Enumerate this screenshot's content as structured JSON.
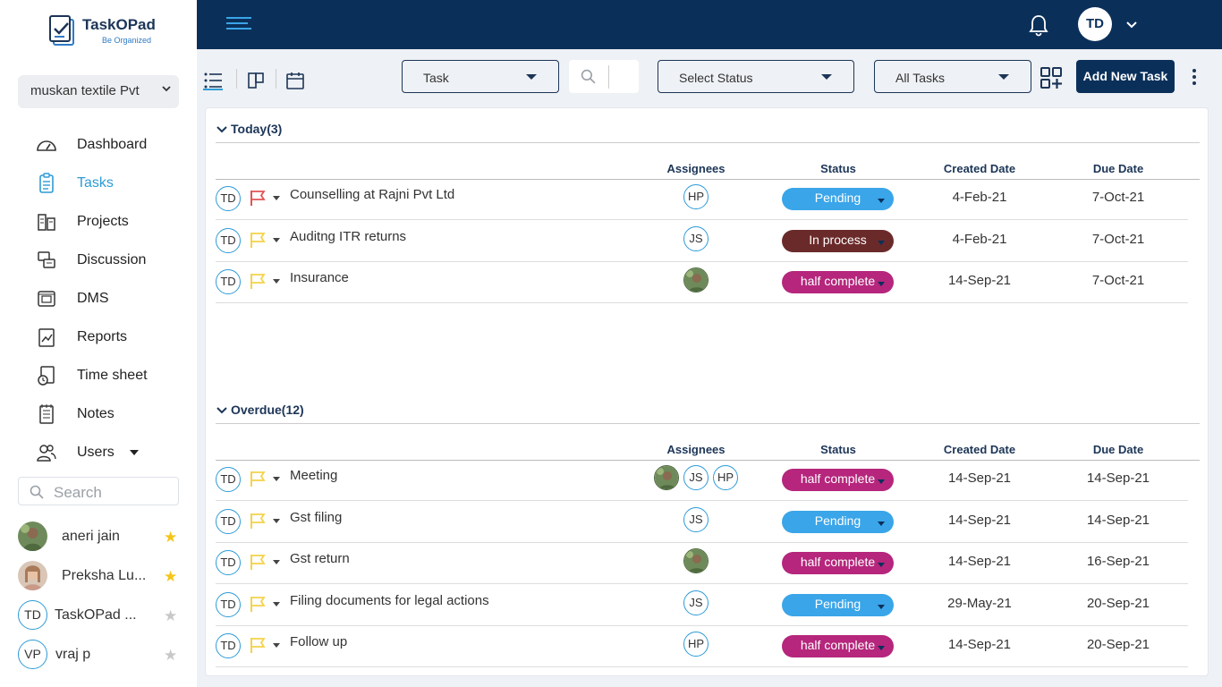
{
  "app": {
    "logo_title": "TaskOPad",
    "logo_tagline": "Be Organized",
    "company": "muskan textile Pvt",
    "colors": {
      "navy": "#0a305a",
      "accent": "#2e9bd6",
      "pending": "#3aa5e8",
      "in_process": "#6b2a2a",
      "half_complete": "#b5267c",
      "flag_red": "#e05555",
      "flag_yellow": "#f4d34a",
      "star_gold": "#f5c518",
      "star_gray": "#c8c8c8"
    }
  },
  "nav": [
    {
      "label": "Dashboard",
      "icon": "speedometer-icon"
    },
    {
      "label": "Tasks",
      "icon": "clipboard-icon",
      "active": true
    },
    {
      "label": "Projects",
      "icon": "projects-icon"
    },
    {
      "label": "Discussion",
      "icon": "discussion-icon"
    },
    {
      "label": "DMS",
      "icon": "dms-icon"
    },
    {
      "label": "Reports",
      "icon": "reports-icon"
    },
    {
      "label": "Time sheet",
      "icon": "clock-icon"
    },
    {
      "label": "Notes",
      "icon": "notes-icon"
    },
    {
      "label": "Users",
      "icon": "users-icon"
    }
  ],
  "sidebar_search": {
    "placeholder": "Search"
  },
  "contacts": [
    {
      "name": "aneri jain",
      "avatar": "photo",
      "starred": true
    },
    {
      "name": "Preksha Lu...",
      "avatar": "photo",
      "starred": true
    },
    {
      "name": "TaskOPad ...",
      "initials": "TD",
      "starred": false
    },
    {
      "name": "vraj p",
      "initials": "VP",
      "starred": false
    }
  ],
  "topbar": {
    "user_initials": "TD"
  },
  "toolbar": {
    "type_select": "Task",
    "status_select": "Select Status",
    "filter_select": "All Tasks",
    "add_button": "Add New Task"
  },
  "columns": {
    "assignees": "Assignees",
    "status": "Status",
    "created": "Created Date",
    "due": "Due Date"
  },
  "sections": [
    {
      "title": "Today(3)",
      "rows": [
        {
          "owner": "TD",
          "flag": "red",
          "name": "Counselling at Rajni Pvt Ltd",
          "assignees": [
            "HP"
          ],
          "status": "Pending",
          "status_type": "pending",
          "created": "4-Feb-21",
          "due": "7-Oct-21"
        },
        {
          "owner": "TD",
          "flag": "yellow",
          "name": "Auditng ITR returns",
          "assignees": [
            "JS"
          ],
          "status": "In process",
          "status_type": "in_process",
          "created": "4-Feb-21",
          "due": "7-Oct-21"
        },
        {
          "owner": "TD",
          "flag": "yellow",
          "name": "Insurance",
          "assignees": [
            "photo"
          ],
          "status": "half complete",
          "status_type": "half_complete",
          "created": "14-Sep-21",
          "due": "7-Oct-21"
        }
      ]
    },
    {
      "title": "Overdue(12)",
      "rows": [
        {
          "owner": "TD",
          "flag": "yellow",
          "name": "Meeting",
          "assignees": [
            "photo",
            "JS",
            "HP"
          ],
          "status": "half complete",
          "status_type": "half_complete",
          "created": "14-Sep-21",
          "due": "14-Sep-21"
        },
        {
          "owner": "TD",
          "flag": "yellow",
          "name": "Gst filing",
          "assignees": [
            "JS"
          ],
          "status": "Pending",
          "status_type": "pending",
          "created": "14-Sep-21",
          "due": "14-Sep-21"
        },
        {
          "owner": "TD",
          "flag": "yellow",
          "name": "Gst return",
          "assignees": [
            "photo"
          ],
          "status": "half complete",
          "status_type": "half_complete",
          "created": "14-Sep-21",
          "due": "16-Sep-21"
        },
        {
          "owner": "TD",
          "flag": "yellow",
          "name": "Filing documents for legal actions",
          "assignees": [
            "JS"
          ],
          "status": "Pending",
          "status_type": "pending",
          "created": "29-May-21",
          "due": "20-Sep-21"
        },
        {
          "owner": "TD",
          "flag": "yellow",
          "name": "Follow up",
          "assignees": [
            "HP"
          ],
          "status": "half complete",
          "status_type": "half_complete",
          "created": "14-Sep-21",
          "due": "20-Sep-21"
        }
      ]
    }
  ]
}
